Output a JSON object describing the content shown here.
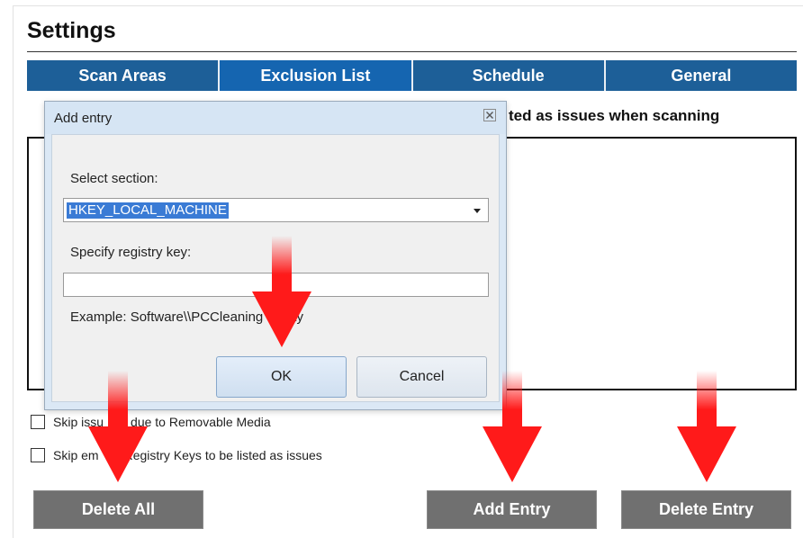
{
  "page": {
    "title": "Settings",
    "tabs": [
      {
        "label": "Scan Areas",
        "active": false
      },
      {
        "label": "Exclusion List",
        "active": true
      },
      {
        "label": "Schedule",
        "active": false
      },
      {
        "label": "General",
        "active": false
      }
    ],
    "list_description_partial": "ted as issues when scanning",
    "checkboxes": [
      {
        "label_start": "Skip issu",
        "label_end": "due to Removable Media",
        "checked": false
      },
      {
        "label_start": "Skip em",
        "label_end": "Registry Keys to be listed as issues",
        "checked": false
      }
    ],
    "buttons": {
      "delete_all": "Delete All",
      "add_entry": "Add Entry",
      "delete_entry": "Delete Entry"
    }
  },
  "dialog": {
    "title": "Add entry",
    "close_icon": "close-icon",
    "select_section_label": "Select section:",
    "section_value": "HKEY_LOCAL_MACHINE",
    "registry_key_label": "Specify registry key:",
    "registry_key_value": "",
    "example_start": "Example: Software\\\\PCCleaning",
    "example_end": "ility",
    "ok_label": "OK",
    "cancel_label": "Cancel"
  },
  "annotations": {
    "arrow_color": "#ff1a1a",
    "arrow_icon": "down-arrow-icon"
  }
}
